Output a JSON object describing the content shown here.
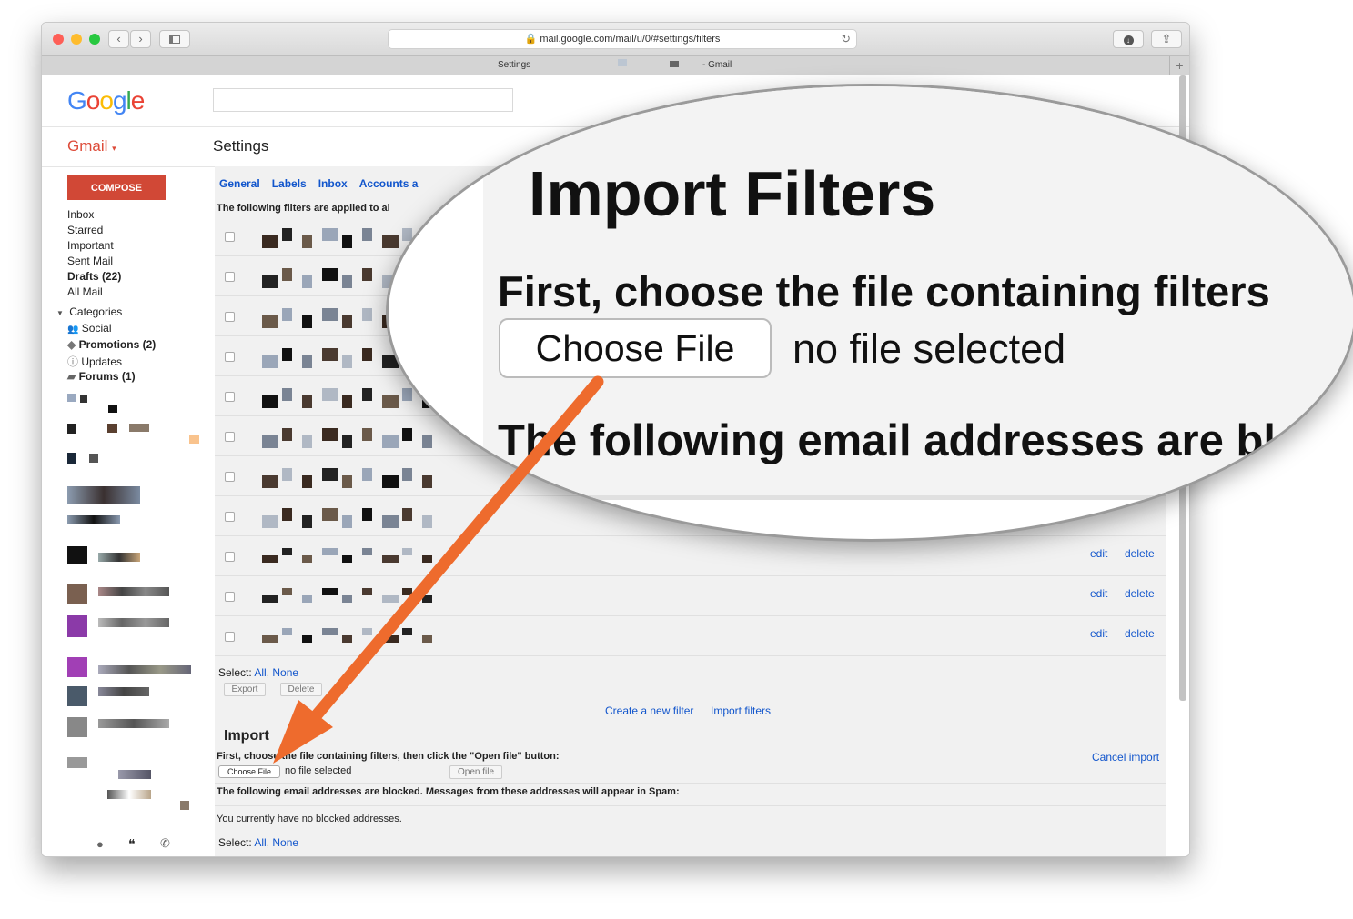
{
  "browser": {
    "url": "mail.google.com/mail/u/0/#settings/filters",
    "tab_left": "Settings",
    "tab_right": "- Gmail",
    "back_icon": "chevron-left-icon",
    "forward_icon": "chevron-right-icon",
    "sidebar_icon": "sidebar-icon",
    "lock_icon": "lock-icon",
    "reload_icon": "reload-icon",
    "download_icon": "download-icon",
    "share_icon": "share-icon",
    "new_tab_label": "+"
  },
  "header": {
    "logo": "Google",
    "logo_colors": [
      "#4285F4",
      "#EA4335",
      "#FBBC05",
      "#4285F4",
      "#34A853",
      "#EA4335"
    ],
    "app_label": "Gmail",
    "page_title": "Settings"
  },
  "sidebar": {
    "compose_label": "COMPOSE",
    "items": [
      "Inbox",
      "Starred",
      "Important",
      "Sent Mail",
      "Drafts (22)",
      "All Mail"
    ],
    "categories_label": "Categories",
    "categories": [
      "Social",
      "Promotions (2)",
      "Updates",
      "Forums (1)"
    ]
  },
  "settings_tabs": [
    "General",
    "Labels",
    "Inbox",
    "Accounts a"
  ],
  "filters": {
    "note": "The following filters are applied to al",
    "edit_label": "edit",
    "delete_label": "delete",
    "select_label": "Select:",
    "select_all": "All",
    "select_none": "None",
    "export_label": "Export",
    "delete_btn_label": "Delete",
    "create_filter": "Create a new filter",
    "import_filters": "Import filters"
  },
  "import_section": {
    "title": "Import",
    "first_line": "First, choose the file containing filters, then click the \"Open file\" button:",
    "choose_file": "Choose File",
    "no_file": "no file selected",
    "open_file": "Open file",
    "cancel_import": "Cancel import",
    "blocked_line": "The following email addresses are blocked. Messages from these addresses will appear in Spam:",
    "no_blocked": "You currently have no blocked addresses.",
    "select_label": "Select:",
    "select_all": "All",
    "select_none": "None"
  },
  "zoom": {
    "title": "Import Filters",
    "first_line": "First, choose the file containing filters",
    "choose_file": "Choose File",
    "no_file": "no file selected",
    "following": "The following email addresses are bl"
  },
  "annotation": {
    "arrow_color": "#ee6b2d"
  }
}
